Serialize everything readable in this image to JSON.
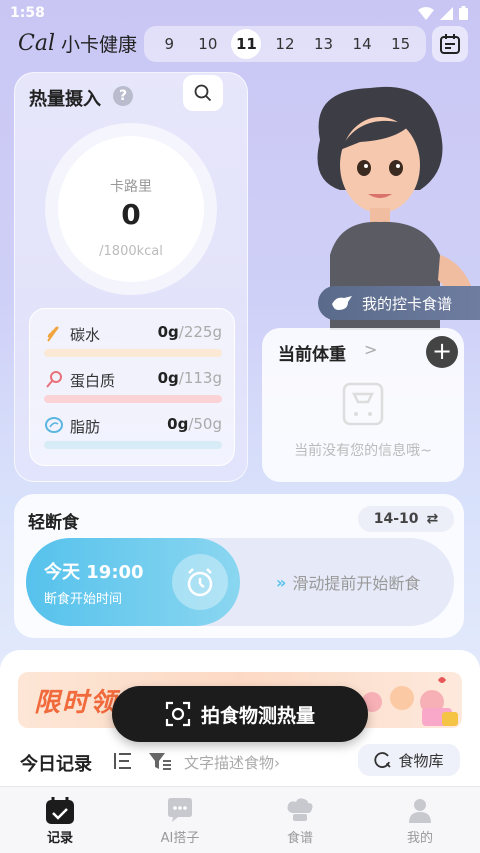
{
  "status": {
    "time": "1:58"
  },
  "header": {
    "logo_mark": "Cal",
    "app_name": "小卡健康",
    "dates": [
      "9",
      "10",
      "11",
      "12",
      "13",
      "14",
      "15"
    ],
    "selected_date": "11"
  },
  "intake": {
    "title": "热量摄入",
    "help": "?",
    "calorie_label": "卡路里",
    "calorie_value": "0",
    "calorie_target": "/1800kcal",
    "macros": [
      {
        "name": "碳水",
        "current": "0g",
        "target": "/225g",
        "bar_color": "#fbe9d6",
        "icon": "wheat-icon",
        "icon_color": "#f0a540"
      },
      {
        "name": "蛋白质",
        "current": "0g",
        "target": "/113g",
        "bar_color": "#fbd3d6",
        "icon": "drumstick-icon",
        "icon_color": "#e9707a"
      },
      {
        "name": "脂肪",
        "current": "0g",
        "target": "/50g",
        "bar_color": "#d8ecf8",
        "icon": "oil-icon",
        "icon_color": "#5ab6e0"
      }
    ]
  },
  "recipe": {
    "label": "我的控卡食谱"
  },
  "weight": {
    "title": "当前体重",
    "chevron": ">",
    "add": "+",
    "empty_text": "当前没有您的信息哦~"
  },
  "fasting": {
    "title": "轻断食",
    "plan": "14-10",
    "plan_icon": "⇄",
    "start_time": "今天 19:00",
    "start_sub": "断食开始时间",
    "hint": "滑动提前开始断食",
    "hint_arrows": "»"
  },
  "promo": {
    "text": "限时领"
  },
  "capture": {
    "label": "拍食物测热量"
  },
  "today": {
    "title": "今日记录",
    "search_placeholder": "文字描述食物",
    "search_chevron": "›",
    "food_library": "食物库"
  },
  "nav": [
    {
      "label": "记录",
      "icon": "calendar-check-icon",
      "active": true
    },
    {
      "label": "AI搭子",
      "icon": "chat-bubble-icon",
      "active": false
    },
    {
      "label": "食谱",
      "icon": "chef-hat-icon",
      "active": false
    },
    {
      "label": "我的",
      "icon": "person-icon",
      "active": false
    }
  ],
  "colors": {
    "accent_blue": "#56c2ec",
    "dark_button": "#1c1c1c",
    "promo_orange": "#f06a3c"
  }
}
